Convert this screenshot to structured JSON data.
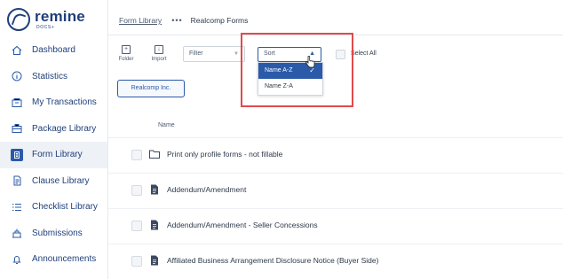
{
  "app": {
    "logo_text": "remine",
    "logo_sub": "DOCS+"
  },
  "sidebar": {
    "items": [
      {
        "label": "Dashboard",
        "icon": "home-icon"
      },
      {
        "label": "Statistics",
        "icon": "info-icon"
      },
      {
        "label": "My Transactions",
        "icon": "transactions-icon"
      },
      {
        "label": "Package Library",
        "icon": "package-icon"
      },
      {
        "label": "Form Library",
        "icon": "form-icon",
        "active": true
      },
      {
        "label": "Clause Library",
        "icon": "clause-icon"
      },
      {
        "label": "Checklist Library",
        "icon": "checklist-icon"
      },
      {
        "label": "Submissions",
        "icon": "submissions-icon"
      },
      {
        "label": "Announcements",
        "icon": "bell-icon"
      }
    ]
  },
  "breadcrumb": {
    "parent": "Form Library",
    "separator": "•••",
    "current": "Realcomp Forms"
  },
  "toolbar": {
    "folder_label": "Folder",
    "import_label": "Import",
    "filter_placeholder": "Filter",
    "sort_label": "Sort",
    "select_all_label": "Select All"
  },
  "sort_menu": {
    "options": [
      "Name A-Z",
      "Name Z-A"
    ],
    "selected": "Name A-Z"
  },
  "tag": {
    "label": "Realcomp Inc."
  },
  "table": {
    "column_name": "Name",
    "rows": [
      {
        "label": "Print only profile forms - not fillable",
        "icon": "folder-icon"
      },
      {
        "label": "Addendum/Amendment",
        "icon": "document-icon"
      },
      {
        "label": "Addendum/Amendment - Seller Concessions",
        "icon": "document-icon"
      },
      {
        "label": "Affiliated Business Arrangement Disclosure Notice (Buyer Side)",
        "icon": "document-icon"
      }
    ]
  },
  "colors": {
    "brand": "#1f3f7a",
    "accent": "#2a5aa8",
    "highlight": "#e24a4a"
  }
}
